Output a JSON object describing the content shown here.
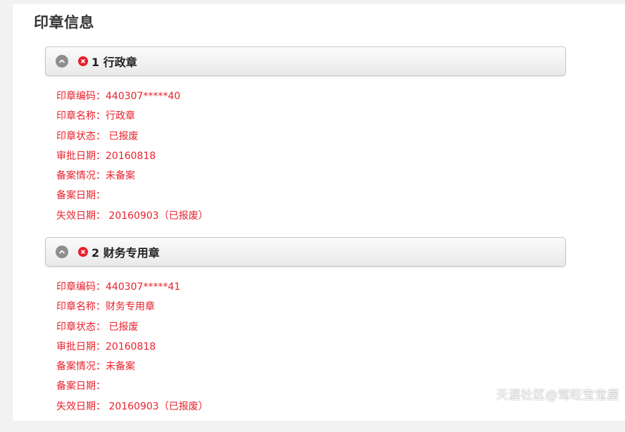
{
  "page": {
    "title": "印章信息"
  },
  "seals": [
    {
      "title": "1 行政章",
      "fields": [
        "印章编码：440307*****40",
        "印章名称：行政章",
        "印章状态： 已报废",
        "审批日期：20160818",
        "备案情况：未备案",
        "备案日期：",
        "失效日期： 20160903（已报废）"
      ]
    },
    {
      "title": "2 财务专用章",
      "fields": [
        "印章编码：440307*****41",
        "印章名称：财务专用章",
        "印章状态： 已报废",
        "审批日期：20160818",
        "备案情况：未备案",
        "备案日期：",
        "失效日期： 20160903（已报废）"
      ]
    }
  ],
  "icons": {
    "collapse": "chevron-up-circle-icon",
    "status": "close-circle-icon"
  },
  "colors": {
    "field_text": "#e8222c",
    "status_icon": "#e5202b",
    "collapse_icon": "#8e8e8e"
  },
  "watermark": "天涯社区@驾旺宝宝屋"
}
